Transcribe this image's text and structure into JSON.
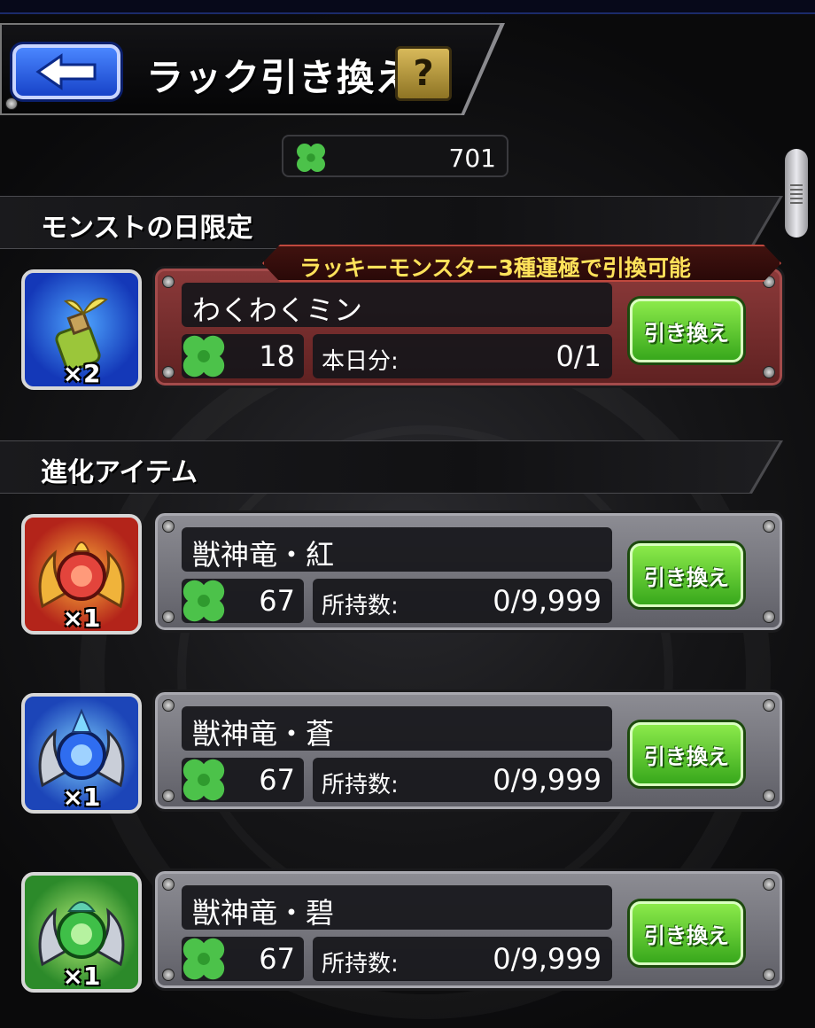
{
  "header": {
    "title": "ラック引き換え",
    "help_label": "?"
  },
  "balance": {
    "value": "701"
  },
  "sections": [
    {
      "title": "モンストの日限定",
      "banner": "ラッキーモンスター3種運極で引換可能",
      "items": [
        {
          "name": "わくわくミン",
          "qty_label": "×2",
          "cost": "18",
          "stat_label": "本日分:",
          "stat_value": "0/1",
          "button": "引き換え",
          "icon": "bottle-sprout-icon"
        }
      ]
    },
    {
      "title": "進化アイテム",
      "items": [
        {
          "name": "獣神竜・紅",
          "qty_label": "×1",
          "cost": "67",
          "stat_label": "所持数:",
          "stat_value": "0/9,999",
          "button": "引き換え",
          "icon": "fire-dragon-orb-icon",
          "color": "#e3443c"
        },
        {
          "name": "獣神竜・蒼",
          "qty_label": "×1",
          "cost": "67",
          "stat_label": "所持数:",
          "stat_value": "0/9,999",
          "button": "引き換え",
          "icon": "water-dragon-orb-icon",
          "color": "#2f6df0"
        },
        {
          "name": "獣神竜・碧",
          "qty_label": "×1",
          "cost": "67",
          "stat_label": "所持数:",
          "stat_value": "0/9,999",
          "button": "引き換え",
          "icon": "wood-dragon-orb-icon",
          "color": "#3fbf48"
        }
      ]
    }
  ]
}
